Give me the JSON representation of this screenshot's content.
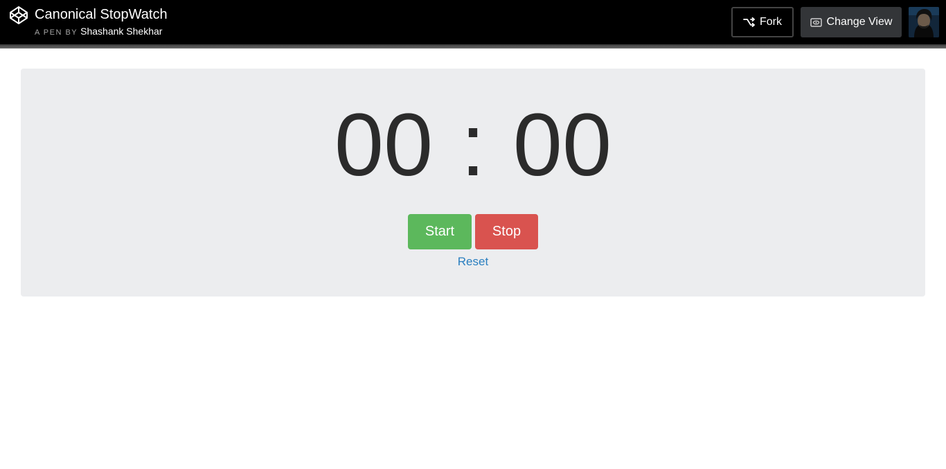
{
  "header": {
    "title": "Canonical StopWatch",
    "by_label": "A PEN BY",
    "author": "Shashank Shekhar",
    "fork_label": "Fork",
    "change_view_label": "Change View",
    "icons": {
      "logo": "codepen-logo-icon",
      "fork": "fork-icon",
      "view": "eye-icon"
    }
  },
  "stopwatch": {
    "minutes": "00",
    "separator": ":",
    "seconds": "00",
    "start_label": "Start",
    "stop_label": "Stop",
    "reset_label": "Reset"
  },
  "colors": {
    "header_bg": "#000000",
    "panel_bg": "#ecedef",
    "start": "#5cb85c",
    "stop": "#d9534f",
    "link": "#2a7fc0",
    "digits": "#2b2b2b"
  }
}
